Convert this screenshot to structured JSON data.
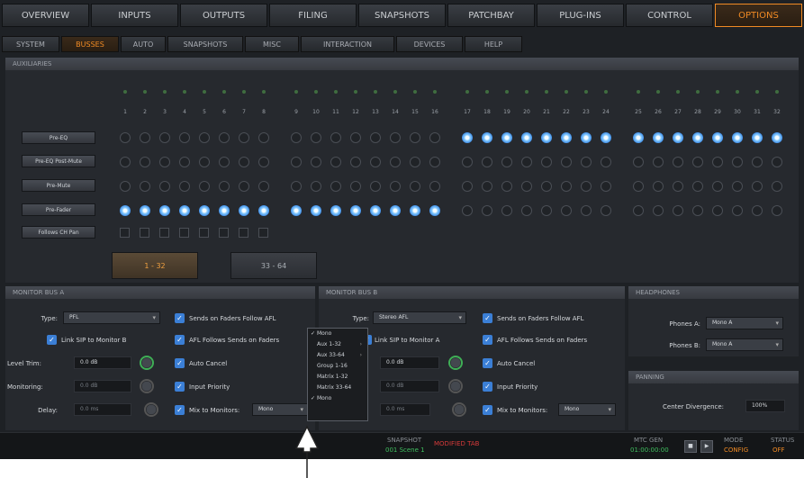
{
  "top_tabs": [
    "OVERVIEW",
    "INPUTS",
    "OUTPUTS",
    "FILING",
    "SNAPSHOTS",
    "PATCHBAY",
    "PLUG-INS",
    "CONTROL",
    "OPTIONS"
  ],
  "sub_tabs": [
    "SYSTEM",
    "BUSSES",
    "AUTO",
    "SNAPSHOTS",
    "MISC",
    "INTERACTION",
    "DEVICES",
    "HELP"
  ],
  "auxiliaries": {
    "title": "AUXILIARIES",
    "bus_numbers": [
      "1",
      "2",
      "3",
      "4",
      "5",
      "6",
      "7",
      "8",
      "9",
      "10",
      "11",
      "12",
      "13",
      "14",
      "15",
      "16",
      "17",
      "18",
      "19",
      "20",
      "21",
      "22",
      "23",
      "24",
      "25",
      "26",
      "27",
      "28",
      "29",
      "30",
      "31",
      "32"
    ],
    "rows": [
      {
        "label": "Pre-EQ",
        "active": [
          17,
          18,
          19,
          20,
          21,
          22,
          23,
          24,
          25,
          26,
          27,
          28,
          29,
          30,
          31,
          32
        ]
      },
      {
        "label": "Pre-EQ Post-Mute",
        "active": []
      },
      {
        "label": "Pre-Mute",
        "active": []
      },
      {
        "label": "Pre-Fader",
        "active": [
          1,
          2,
          3,
          4,
          5,
          6,
          7,
          8,
          9,
          10,
          11,
          12,
          13,
          14,
          15,
          16
        ]
      },
      {
        "label": "Follows CH Pan",
        "active": []
      }
    ],
    "range_buttons": [
      "1 - 32",
      "33 - 64"
    ]
  },
  "monitor_a": {
    "title": "MONITOR BUS A",
    "type_label": "Type:",
    "type_value": "PFL",
    "link_label": "Link SIP to Monitor B",
    "level_trim_label": "Level Trim:",
    "level_trim_value": "0.0 dB",
    "monitoring_label": "Monitoring:",
    "monitoring_value": "0.0 dB",
    "delay_label": "Delay:",
    "delay_value": "0.0 ms",
    "sends_follow": "Sends on Faders Follow AFL",
    "afl_follows": "AFL Follows Sends on Faders",
    "auto_cancel": "Auto Cancel",
    "input_priority": "Input Priority",
    "mix_to_monitors": "Mix to Monitors:",
    "mix_value": "Mono"
  },
  "monitor_b": {
    "title": "MONITOR BUS B",
    "type_label": "Type:",
    "type_value": "Stereo AFL",
    "link_label": "Link SIP to Monitor A",
    "level_trim_value": "0.0 dB",
    "monitoring_value": "0.0 dB",
    "delay_value": "0.0 ms",
    "sends_follow": "Sends on Faders Follow AFL",
    "afl_follows": "AFL Follows Sends on Faders",
    "auto_cancel": "Auto Cancel",
    "input_priority": "Input Priority",
    "mix_to_monitors": "Mix to Monitors:",
    "mix_value": "Mono"
  },
  "headphones": {
    "title": "HEADPHONES",
    "phones_a_label": "Phones A:",
    "phones_a_value": "Mono A",
    "phones_b_label": "Phones B:",
    "phones_b_value": "Mono A"
  },
  "panning": {
    "title": "PANNING",
    "center_label": "Center Divergence:",
    "center_value": "100%"
  },
  "dropdown_menu": [
    "Mono",
    "Aux 1-32",
    "Aux 33-64",
    "Group 1-16",
    "Matrix 1-32",
    "Matrix 33-64",
    "Mono"
  ],
  "status_bar": {
    "snapshot_label": "SNAPSHOT",
    "snapshot_name": "001 Scene 1",
    "snapshot_status": "MODIFIED TAB",
    "mtc_label": "MTC GEN",
    "mtc_time": "01:00:00:00",
    "mode_label": "MODE",
    "mode_value": "CONFIG",
    "status_label": "STATUS",
    "status_value": "OFF"
  },
  "colors": {
    "accent": "#f08a24",
    "active_dot": "#3f8ee8",
    "checkbox": "#3b7fd6",
    "ok": "#3fbf5f",
    "warn": "#d63a3a"
  }
}
